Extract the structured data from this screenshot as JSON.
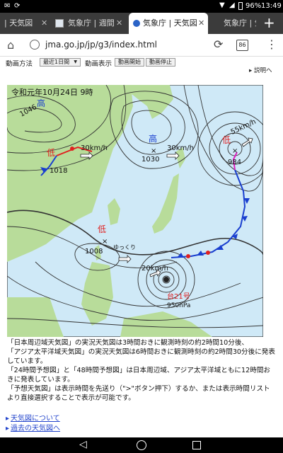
{
  "status_bar": {
    "battery": "96%",
    "time": "13:49"
  },
  "tabs": [
    {
      "title": "| 天気図",
      "active": false
    },
    {
      "title": "気象庁 | 週間",
      "active": false
    },
    {
      "title": "気象庁 | 天気図",
      "active": true
    },
    {
      "title": "気象庁 | 気",
      "active": false
    }
  ],
  "new_tab_label": "+",
  "address_bar": {
    "url": "jma.go.jp/jp/g3/index.html",
    "tab_count": "86"
  },
  "controls": {
    "method_label": "動画方法",
    "method_selected": "最近1日間",
    "display_label": "動画表示",
    "start_button": "動画開始",
    "stop_button": "動画停止",
    "help_link": "説明へ"
  },
  "map": {
    "date_label": "令和元年10月24日 9時",
    "highs": [
      {
        "symbol": "高",
        "pressure": "1046"
      },
      {
        "symbol": "高",
        "pressure": "1030"
      }
    ],
    "lows": [
      {
        "symbol": "低",
        "pressure": "1018"
      },
      {
        "symbol": "低",
        "pressure": "1008"
      },
      {
        "symbol": "低",
        "pressure": "984"
      }
    ],
    "speeds": [
      "30km/h",
      "30km/h",
      "55km/h",
      "20km/h"
    ],
    "slow_label": "ゆっくり",
    "typhoon_name": "台21号",
    "typhoon_pressure": "950hPa",
    "colors": {
      "sea": "#cfe9f7",
      "land": "#b8dc9a",
      "front_cold": "#1a3fcf",
      "front_warm": "#e02020"
    }
  },
  "description": [
    "「日本周辺域天気図」の実況天気図は3時間おきに観測時刻の約2時間10分後、",
    "「アジア太平洋域天気図」の実況天気図は6時間おきに観測時刻の約2時間30分後に発表しています。",
    "「24時間予想図」と「48時間予想図」は日本周辺域、アジア太平洋域ともに12時間おきに発表しています。",
    "「予想天気図」は表示時間を先送り（\">\"ボタン押下）するか、または表示時間リストより直接選択することで表示が可能です。"
  ],
  "links": [
    "天気図について",
    "過去の天気図へ"
  ]
}
